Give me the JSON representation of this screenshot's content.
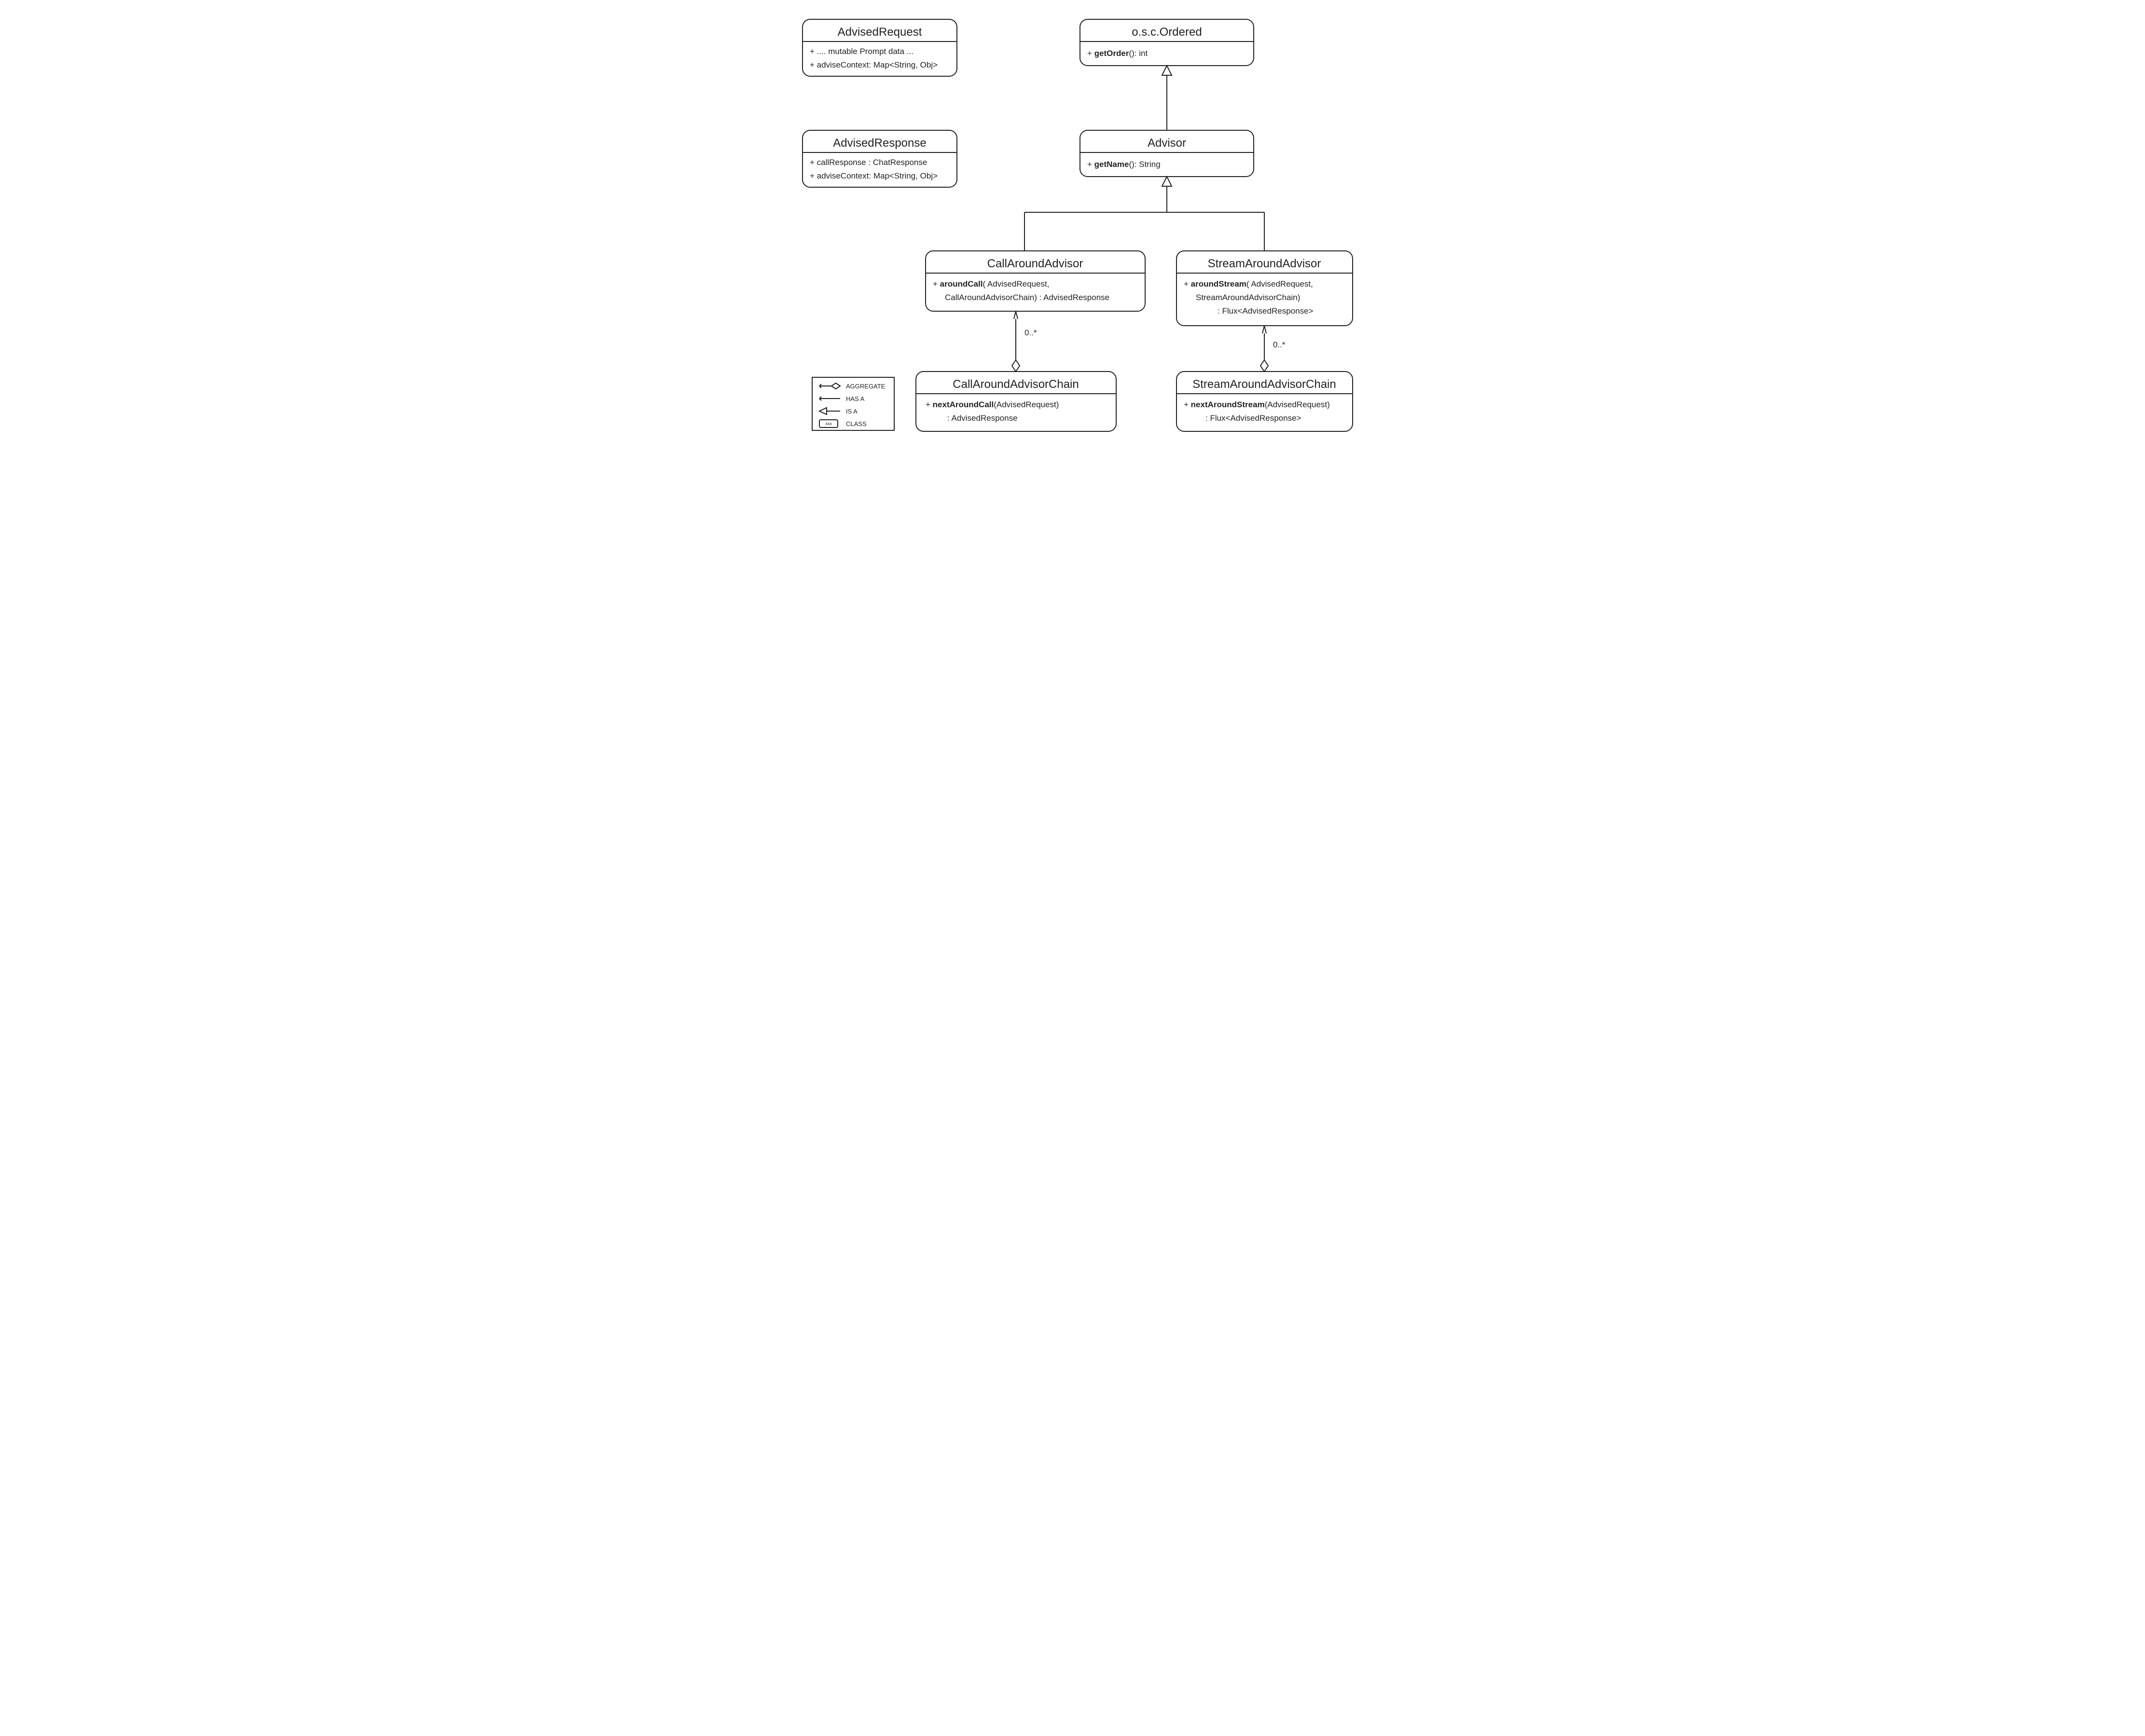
{
  "classes": {
    "advisedRequest": {
      "title": "AdvisedRequest",
      "attrs": [
        "+ .... mutable Prompt data ...",
        "+ adviseContext: Map<String, Obj>"
      ]
    },
    "advisedResponse": {
      "title": "AdvisedResponse",
      "attrs": [
        "+ callResponse : ChatResponse",
        "+ adviseContext: Map<String, Obj>"
      ]
    },
    "ordered": {
      "title": "o.s.c.Ordered",
      "attr_prefix": "+ ",
      "attr_bold": "getOrder",
      "attr_suffix": "(): int"
    },
    "advisor": {
      "title": "Advisor",
      "attr_prefix": "+ ",
      "attr_bold": "getName",
      "attr_suffix": "(): String"
    },
    "callAroundAdvisor": {
      "title": "CallAroundAdvisor",
      "attr_prefix": "+ ",
      "attr_bold": "aroundCall",
      "attr_suffix": "( AdvisedRequest,",
      "attr_line2": "CallAroundAdvisorChain) : AdvisedResponse"
    },
    "streamAroundAdvisor": {
      "title": "StreamAroundAdvisor",
      "attr_prefix": "+ ",
      "attr_bold": "aroundStream",
      "attr_suffix": "( AdvisedRequest,",
      "attr_line2": "StreamAroundAdvisorChain)",
      "attr_line3": ": Flux<AdvisedResponse>"
    },
    "callAroundAdvisorChain": {
      "title": "CallAroundAdvisorChain",
      "attr_prefix": "+ ",
      "attr_bold": "nextAroundCall",
      "attr_suffix": "(AdvisedRequest)",
      "attr_line2": ": AdvisedResponse"
    },
    "streamAroundAdvisorChain": {
      "title": "StreamAroundAdvisorChain",
      "attr_prefix": "+ ",
      "attr_bold": "nextAroundStream",
      "attr_suffix": "(AdvisedRequest)",
      "attr_line2": ": Flux<AdvisedResponse>"
    }
  },
  "multiplicity": {
    "callAgg": "0..*",
    "streamAgg": "0..*"
  },
  "legend": {
    "aggregate": "AGGREGATE",
    "hasA": "HAS A",
    "isA": "IS A",
    "class": "CLASS",
    "classSample": "xxx"
  }
}
